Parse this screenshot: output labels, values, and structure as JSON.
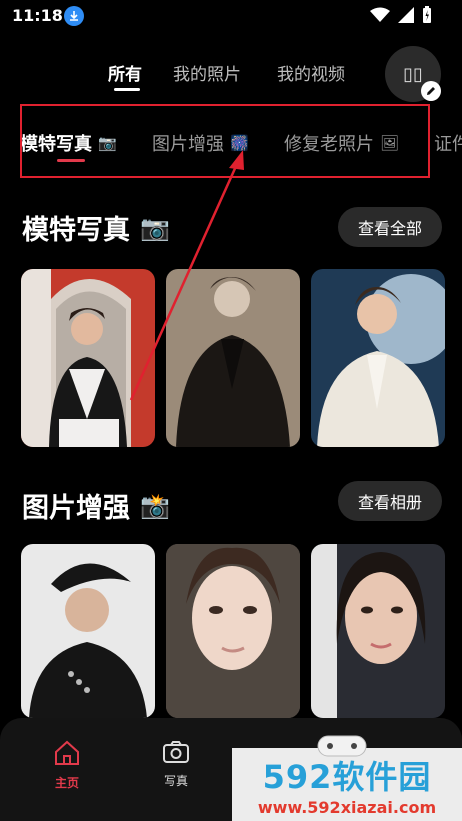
{
  "status_bar": {
    "time": "11:18",
    "icons": [
      "download-icon",
      "wifi-icon",
      "signal-icon",
      "battery-icon"
    ]
  },
  "top_tabs": [
    {
      "label": "所有",
      "active": true
    },
    {
      "label": "我的照片",
      "active": false
    },
    {
      "label": "我的视频",
      "active": false
    }
  ],
  "avatar": {
    "text": "▯▯"
  },
  "category_tabs": [
    {
      "label": "模特写真",
      "emoji": "📷",
      "active": true
    },
    {
      "label": "图片增强",
      "emoji": "🎆",
      "active": false
    },
    {
      "label": "修复老照片",
      "emoji": "🖼",
      "active": false
    },
    {
      "label": "证件",
      "emoji": "",
      "active": false
    }
  ],
  "sections": [
    {
      "title": "模特写真",
      "emoji": "📷",
      "button": "查看全部"
    },
    {
      "title": "图片增强",
      "emoji": "📸",
      "button": "查看相册"
    }
  ],
  "bottom_nav": [
    {
      "label": "主页",
      "icon": "home-icon",
      "active": true
    },
    {
      "label": "写真",
      "icon": "camera-icon",
      "active": false
    }
  ],
  "watermark": {
    "title": "592软件园",
    "url": "www.592xiazai.com"
  },
  "colors": {
    "accent": "#e23a4b",
    "annotation": "#e0212f",
    "background": "#000000"
  }
}
